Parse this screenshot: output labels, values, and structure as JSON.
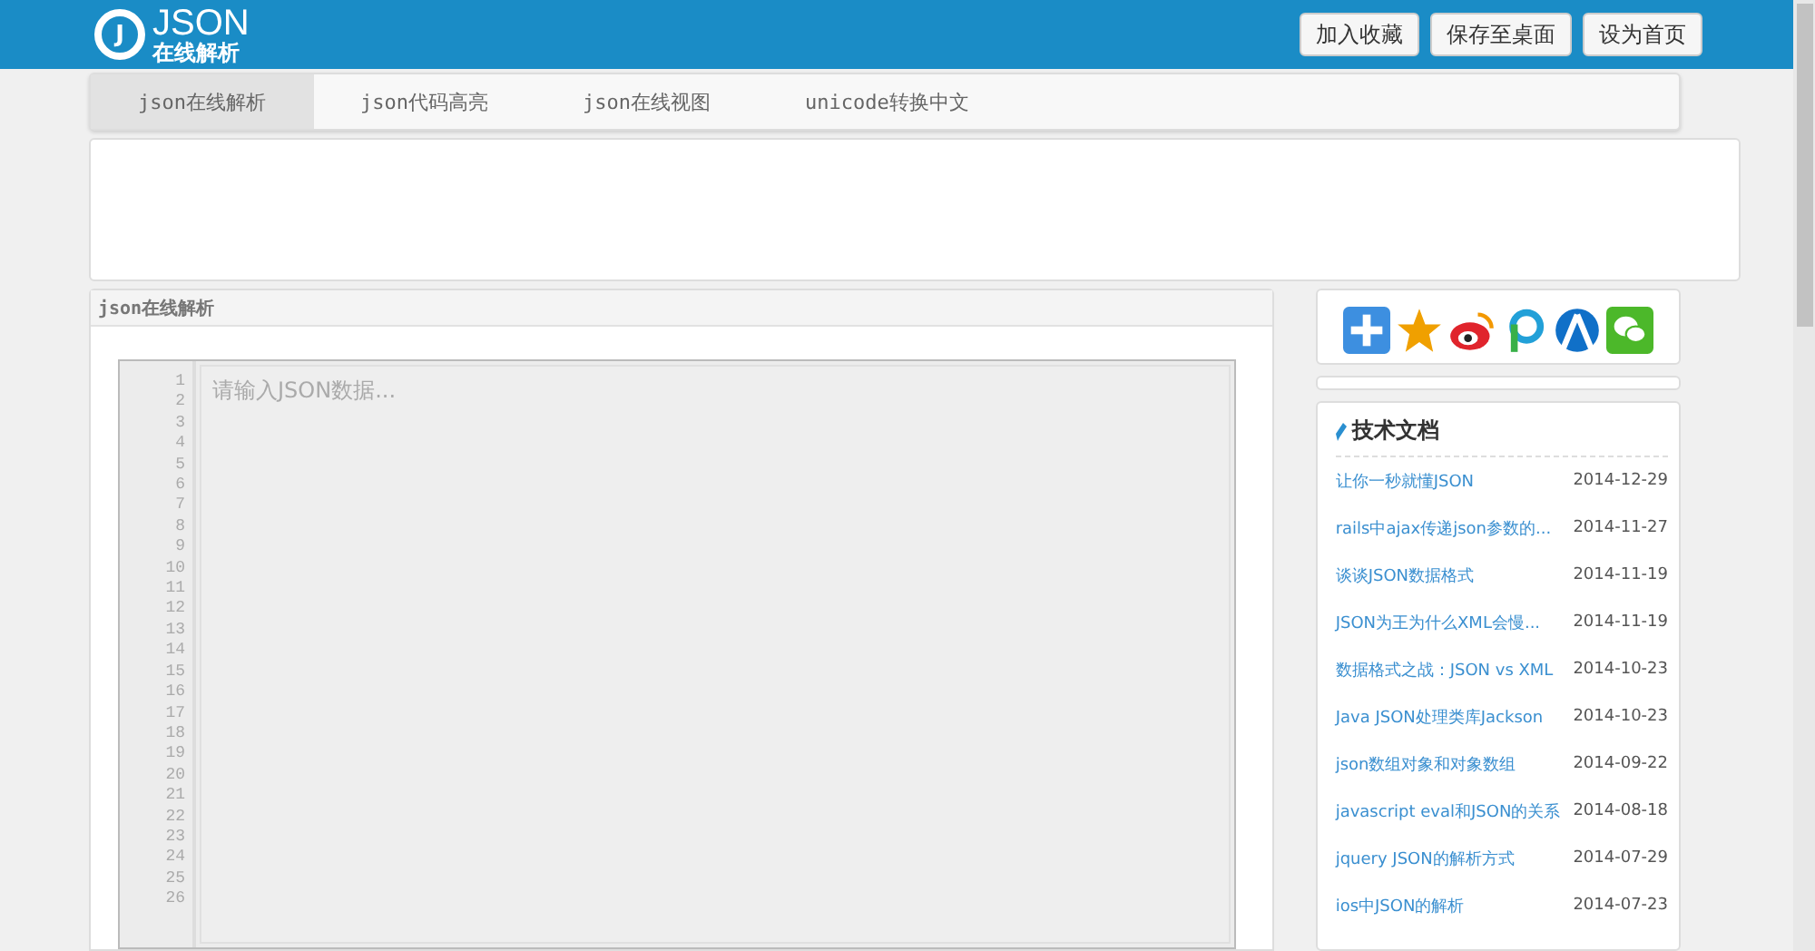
{
  "header": {
    "logo": {
      "mark": "J",
      "title": "JSON",
      "subtitle": "在线解析"
    },
    "buttons": [
      "加入收藏",
      "保存至桌面",
      "设为首页"
    ]
  },
  "tabs": [
    {
      "label": "json在线解析",
      "selected": true
    },
    {
      "label": "json代码高亮",
      "selected": false
    },
    {
      "label": "json在线视图",
      "selected": false
    },
    {
      "label": "unicode转换中文",
      "selected": false
    }
  ],
  "panel": {
    "title": "json在线解析",
    "editor": {
      "placeholder": "请输入JSON数据...",
      "line_numbers": [
        "1",
        "2",
        "3",
        "4",
        "5",
        "6",
        "7",
        "8",
        "9",
        "10",
        "11",
        "12",
        "13",
        "14",
        "15",
        "16",
        "17",
        "18",
        "19",
        "20",
        "21",
        "22",
        "23",
        "24",
        "25",
        "26"
      ]
    }
  },
  "share": {
    "icons": [
      {
        "kind": "plus"
      },
      {
        "kind": "star"
      },
      {
        "kind": "weibo"
      },
      {
        "kind": "p"
      },
      {
        "kind": "person"
      },
      {
        "kind": "wechat"
      }
    ]
  },
  "articles": {
    "title": "技术文档",
    "items": [
      {
        "title": "让你一秒就懂JSON",
        "date": "2014-12-29"
      },
      {
        "title": "rails中ajax传递json参数的...",
        "date": "2014-11-27"
      },
      {
        "title": "谈谈JSON数据格式",
        "date": "2014-11-19"
      },
      {
        "title": "JSON为王为什么XML会慢...",
        "date": "2014-11-19"
      },
      {
        "title": "数据格式之战：JSON vs XML",
        "date": "2014-10-23"
      },
      {
        "title": "Java JSON处理类库Jackson",
        "date": "2014-10-23"
      },
      {
        "title": "json数组对象和对象数组",
        "date": "2014-09-22"
      },
      {
        "title": "javascript eval和JSON的关系",
        "date": "2014-08-18"
      },
      {
        "title": "jquery JSON的解析方式",
        "date": "2014-07-29"
      },
      {
        "title": "ios中JSON的解析",
        "date": "2014-07-23"
      }
    ]
  }
}
